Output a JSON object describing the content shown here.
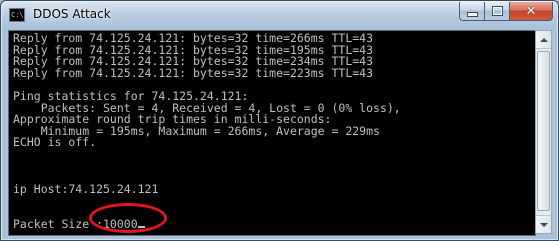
{
  "window": {
    "title": "DDOS Attack",
    "app_icon_label": "C:\\",
    "controls": {
      "minimize_icon": "minimize-icon",
      "maximize_icon": "maximize-icon",
      "close_icon": "close-icon",
      "close_glyph": "✕"
    }
  },
  "console": {
    "lines": [
      "Reply from 74.125.24.121: bytes=32 time=266ms TTL=43",
      "Reply from 74.125.24.121: bytes=32 time=195ms TTL=43",
      "Reply from 74.125.24.121: bytes=32 time=234ms TTL=43",
      "Reply from 74.125.24.121: bytes=32 time=223ms TTL=43",
      "",
      "Ping statistics for 74.125.24.121:",
      "    Packets: Sent = 4, Received = 4, Lost = 0 (0% loss),",
      "Approximate round trip times in milli-seconds:",
      "    Minimum = 195ms, Maximum = 266ms, Average = 229ms",
      "ECHO is off.",
      "",
      "",
      "",
      "ip Host:74.125.24.121",
      "",
      "",
      "Packet Size :10000"
    ]
  },
  "colors": {
    "console_bg": "#000000",
    "console_text": "#c0c0c0",
    "highlight": "#e3161b"
  }
}
